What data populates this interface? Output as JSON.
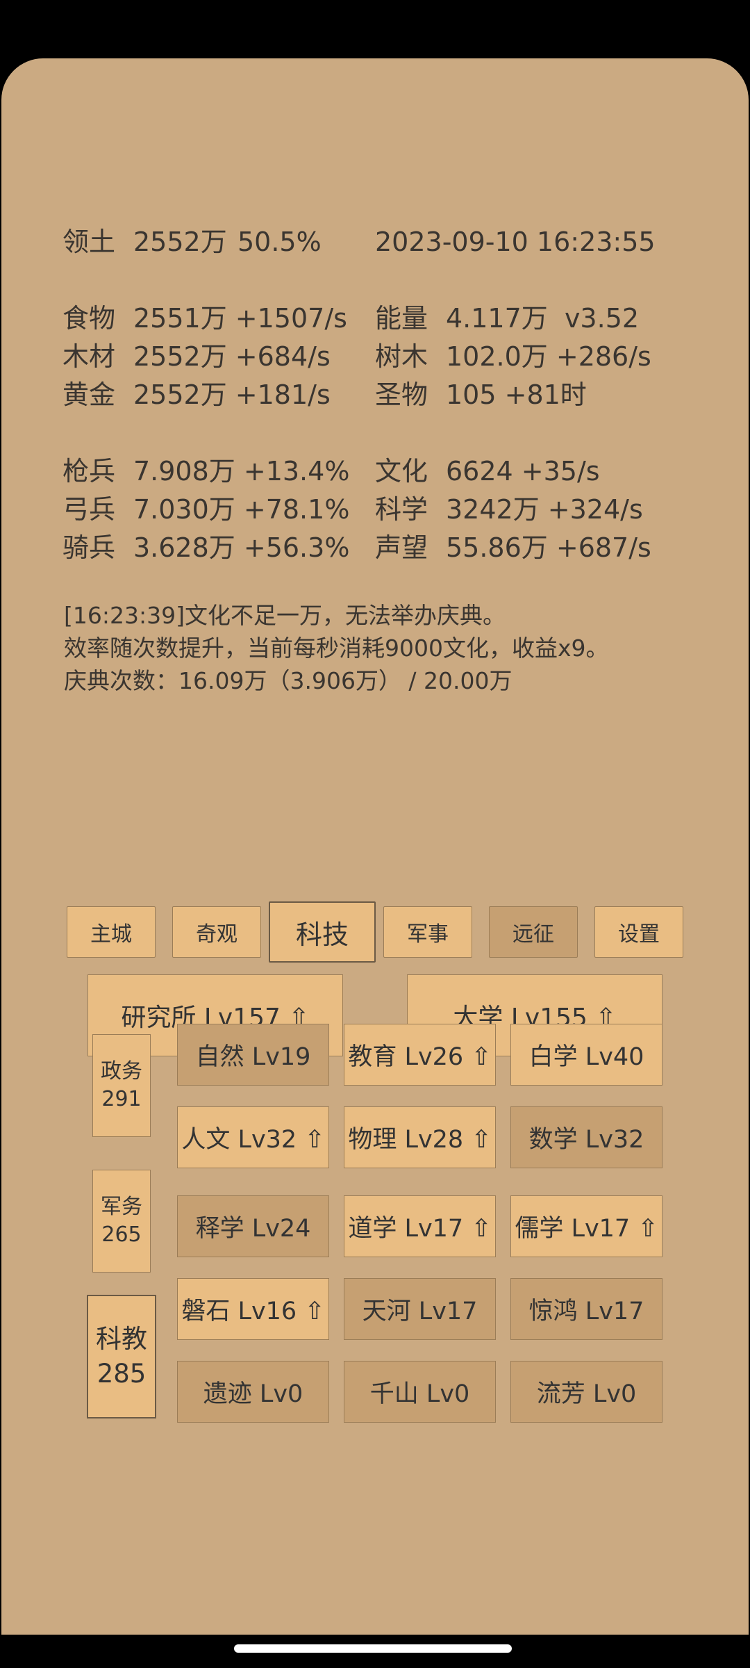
{
  "header": {
    "territory_label": "领土",
    "territory_value": "2552万",
    "territory_pct": "50.5%",
    "datetime": "2023-09-10 16:23:55"
  },
  "resources": [
    {
      "label": "食物",
      "value": "2551万 +1507/s"
    },
    {
      "label": "木材",
      "value": "2552万 +684/s"
    },
    {
      "label": "黄金",
      "value": "2552万 +181/s"
    },
    {
      "label": "能量",
      "value": "4.117万  v3.52"
    },
    {
      "label": "树木",
      "value": "102.0万 +286/s"
    },
    {
      "label": "圣物",
      "value": "105 +81时"
    }
  ],
  "military": [
    {
      "label": "枪兵",
      "value": "7.908万 +13.4%"
    },
    {
      "label": "弓兵",
      "value": "7.030万 +78.1%"
    },
    {
      "label": "骑兵",
      "value": "3.628万 +56.3%"
    },
    {
      "label": "文化",
      "value": "6624 +35/s"
    },
    {
      "label": "科学",
      "value": "3242万 +324/s"
    },
    {
      "label": "声望",
      "value": "55.86万 +687/s"
    }
  ],
  "messages": [
    "[16:23:39]文化不足一万，无法举办庆典。",
    "效率随次数提升，当前每秒消耗9000文化，收益x9。",
    "庆典次数：16.09万（3.906万） / 20.00万"
  ],
  "tabs": [
    {
      "label": "主城"
    },
    {
      "label": "奇观"
    },
    {
      "label": "科技",
      "selected": true
    },
    {
      "label": "军事"
    },
    {
      "label": "远征"
    },
    {
      "label": "设置"
    }
  ],
  "buildings": [
    {
      "label": "研究所 Lv157 ⇧"
    },
    {
      "label": "大学 Lv155 ⇧"
    }
  ],
  "categories": [
    {
      "name": "政务",
      "value": "291"
    },
    {
      "name": "军务",
      "value": "265"
    },
    {
      "name": "科教",
      "value": "285",
      "selected": true
    }
  ],
  "techs": [
    {
      "label": "自然 Lv19"
    },
    {
      "label": "教育 Lv26 ⇧"
    },
    {
      "label": "白学 Lv40"
    },
    {
      "label": "人文 Lv32 ⇧"
    },
    {
      "label": "物理 Lv28 ⇧"
    },
    {
      "label": "数学 Lv32"
    },
    {
      "label": "释学 Lv24"
    },
    {
      "label": "道学 Lv17 ⇧"
    },
    {
      "label": "儒学 Lv17 ⇧"
    },
    {
      "label": "磐石 Lv16 ⇧"
    },
    {
      "label": "天河 Lv17"
    },
    {
      "label": "惊鸿 Lv17"
    },
    {
      "label": "遗迹 Lv0"
    },
    {
      "label": "千山 Lv0"
    },
    {
      "label": "流芳 Lv0"
    }
  ],
  "colors": {
    "panel": "#cbaa82",
    "button_light": "#e9bd83",
    "button_dark": "#c6a072"
  }
}
